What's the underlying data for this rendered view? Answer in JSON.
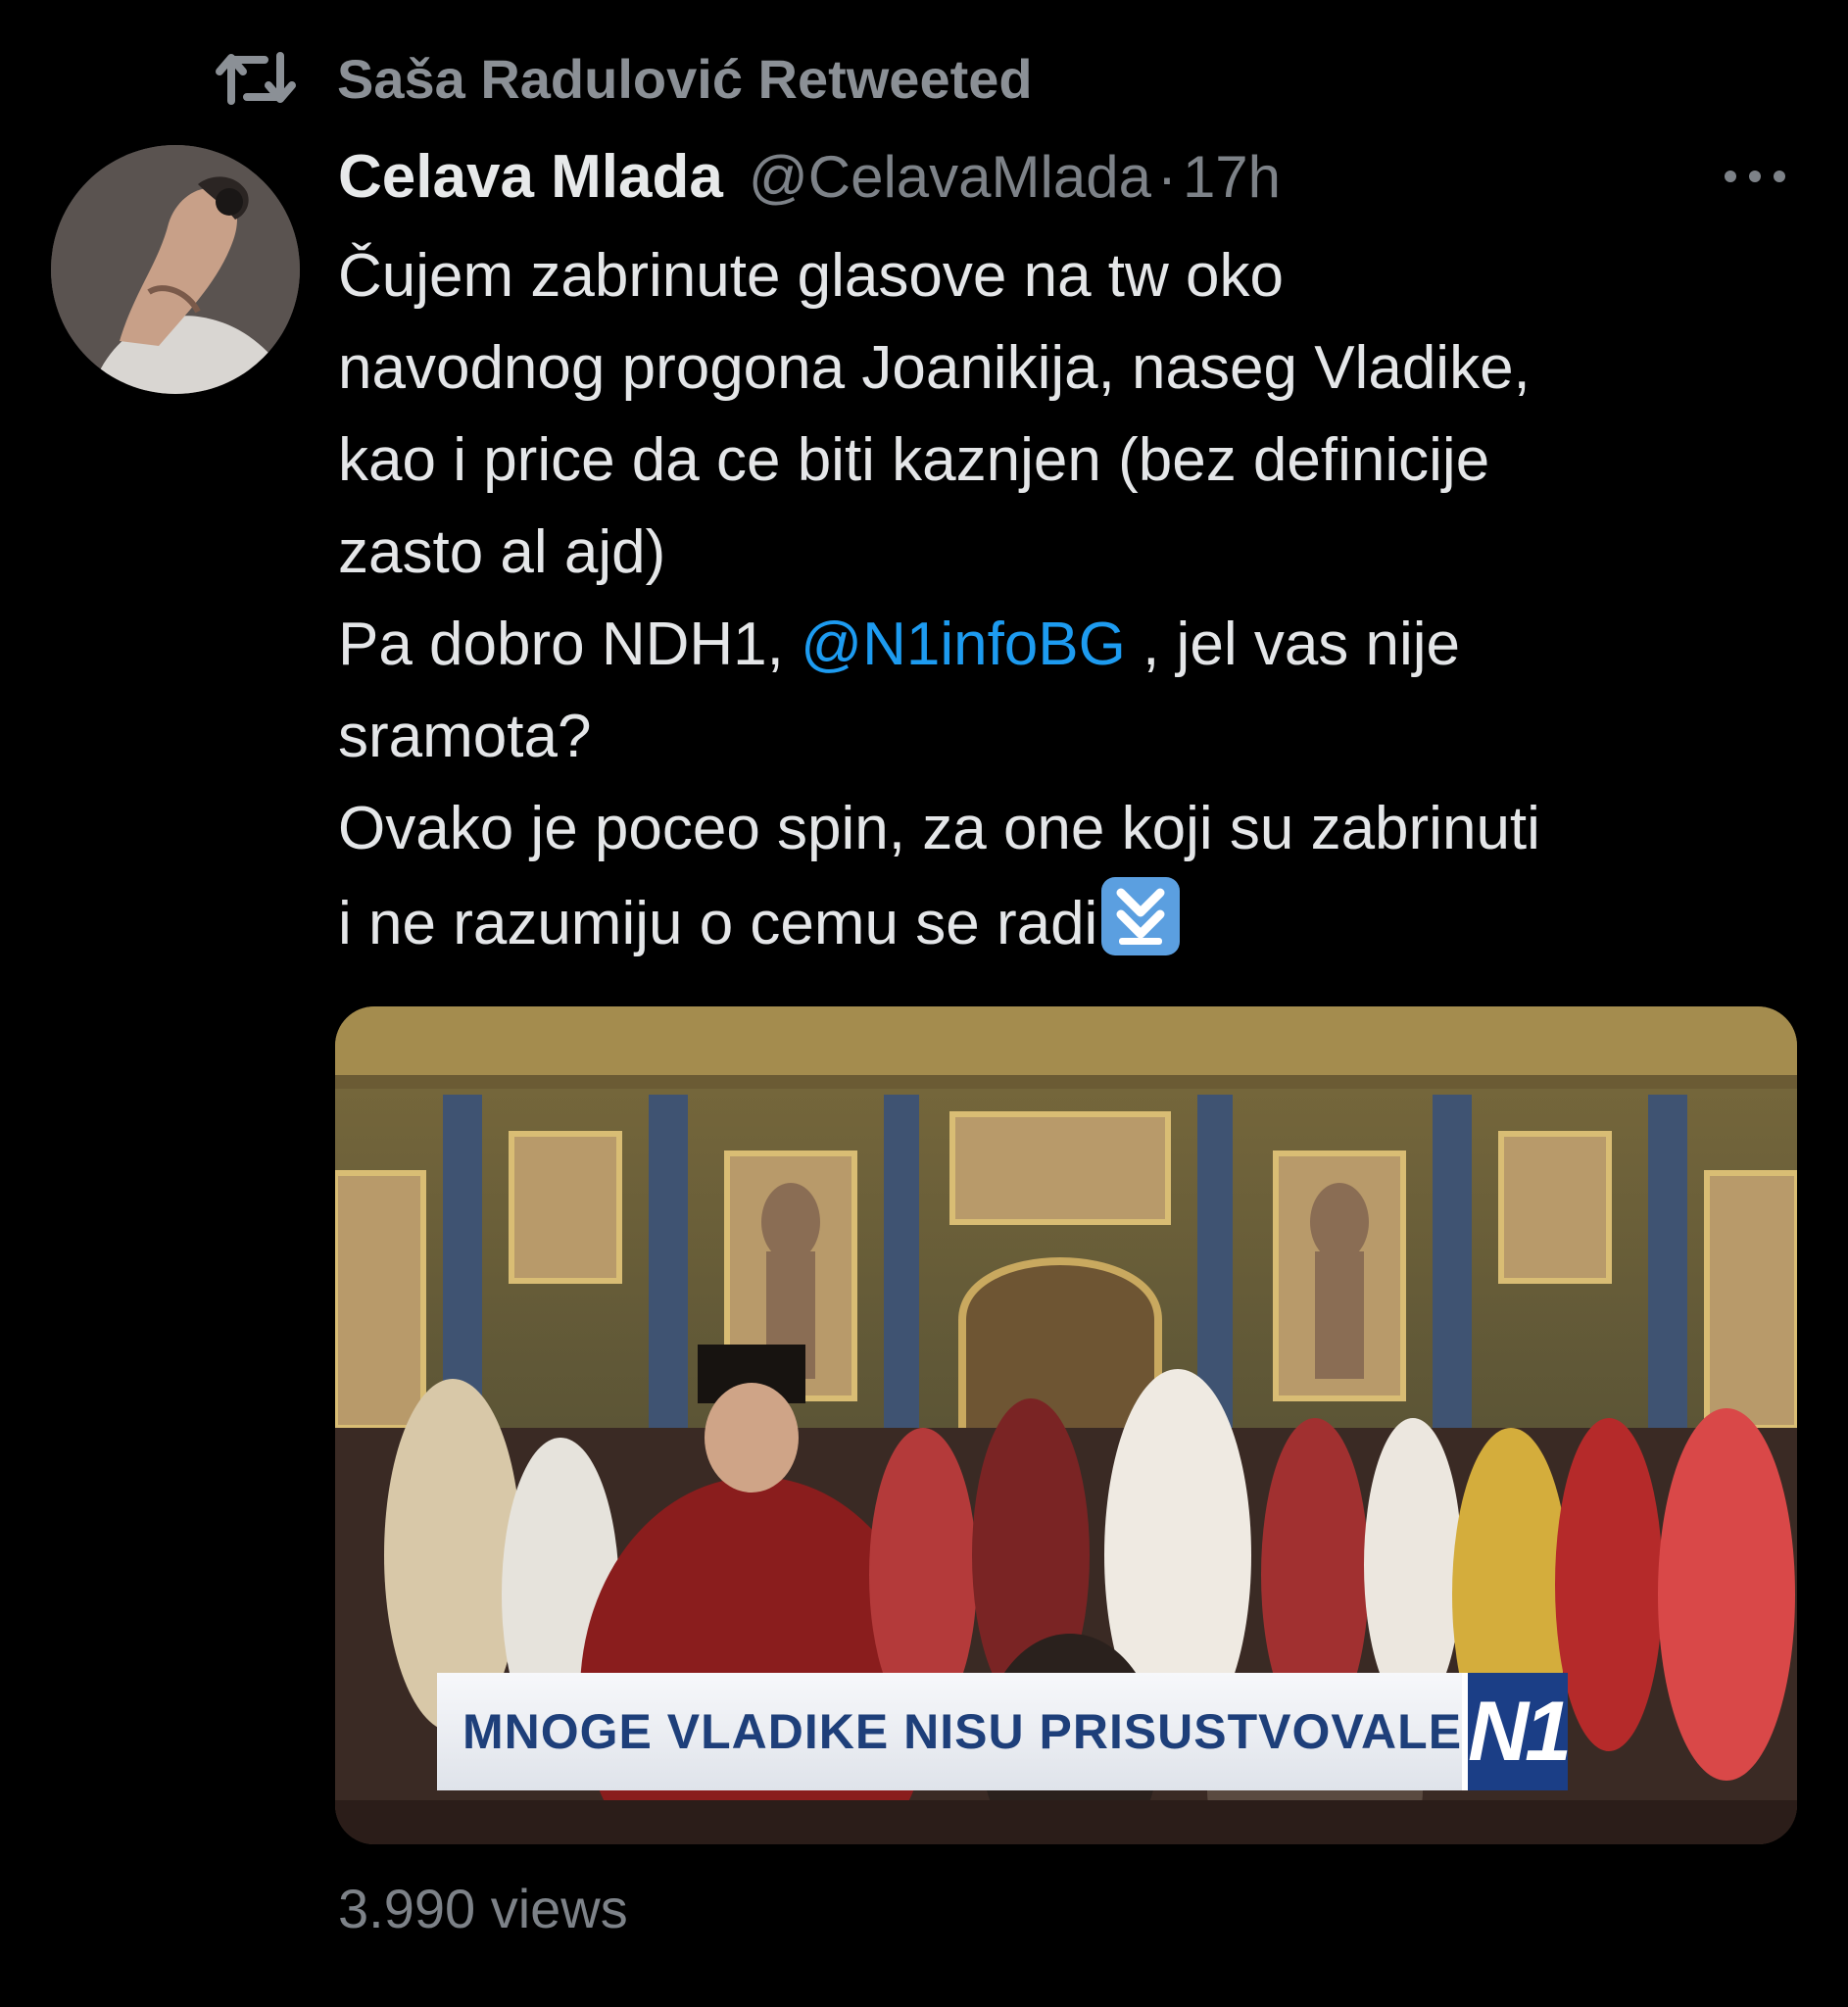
{
  "retweet": {
    "icon": "retweet-icon",
    "label": "Saša Radulović Retweeted"
  },
  "tweet": {
    "avatar": "avatar",
    "display_name": "Celava Mlada",
    "handle": "@CelavaMlada",
    "separator": "·",
    "time": "17h",
    "more_icon": "more-horizontal-icon",
    "lines": [
      "Čujem zabrinute glasove na tw oko",
      "navodnog progona Joanikija, naseg Vladike,",
      "kao i price da ce biti kaznjen (bez definicije",
      "zasto al ajd)",
      "Pa dobro NDH1,",
      "@N1infoBG",
      ", jel vas nije",
      "sramota?",
      "Ovako je poceo spin, za one koji su zabrinuti",
      "i ne razumiju o cemu se radi"
    ],
    "emoji": "double-down-arrow-emoji",
    "media": {
      "lower_third": "MNOGE VLADIKE NISU PRISUSTVOVALE",
      "logo": "N1"
    },
    "views": "3.990 views"
  },
  "colors": {
    "background": "#000000",
    "text": "#e7e9ea",
    "secondary": "#7d8288",
    "link": "#1d9bf0",
    "lower_third_text": "#1e3f7a",
    "logo_bg": "#1b3e86"
  }
}
